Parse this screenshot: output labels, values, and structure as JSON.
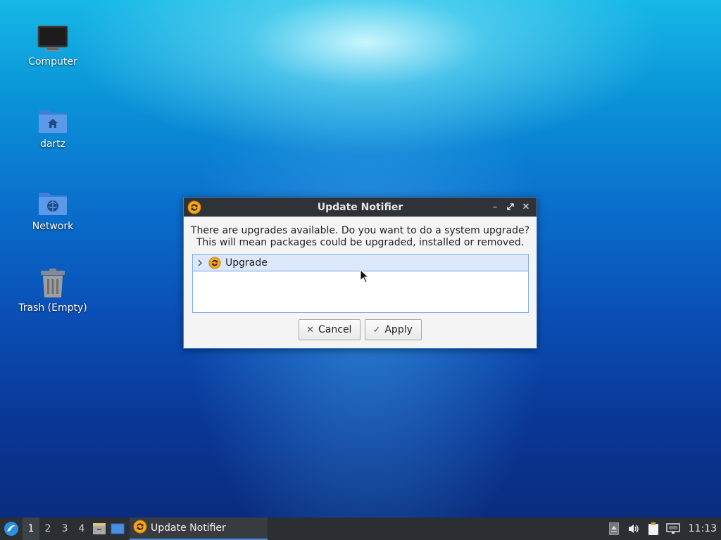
{
  "desktop": {
    "icons": [
      {
        "label": "Computer",
        "icon": "computer-icon"
      },
      {
        "label": "dartz",
        "icon": "home-folder-icon"
      },
      {
        "label": "Network",
        "icon": "network-folder-icon"
      },
      {
        "label": "Trash (Empty)",
        "icon": "trash-icon"
      }
    ]
  },
  "dialog": {
    "title": "Update Notifier",
    "message_line1": "There are upgrades available. Do you want to do a system upgrade?",
    "message_line2": "This will mean packages could be upgraded, installed or removed.",
    "tree": {
      "items": [
        {
          "label": "Upgrade",
          "icon": "update-icon",
          "expanded": false
        }
      ]
    },
    "buttons": {
      "cancel_label": "Cancel",
      "apply_label": "Apply"
    }
  },
  "taskbar": {
    "workspaces": [
      "1",
      "2",
      "3",
      "4"
    ],
    "active_workspace": "1",
    "task_label": "Update Notifier",
    "clock": "11:13"
  },
  "colors": {
    "accent": "#4a90e2",
    "titlebar": "#2f3338",
    "taskbar": "#2b2f33"
  }
}
